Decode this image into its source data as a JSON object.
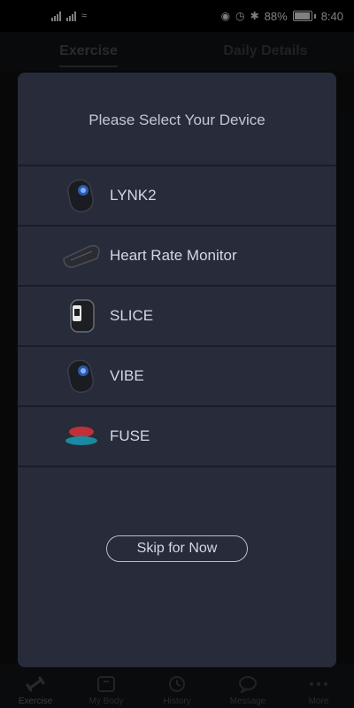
{
  "status_bar": {
    "battery": "88%",
    "time": "8:40"
  },
  "app": {
    "tabs": [
      "Exercise",
      "Daily Details"
    ],
    "bottom_nav": [
      {
        "label": "Exercise",
        "icon": "dumbbell-icon"
      },
      {
        "label": "My Body",
        "icon": "scale-icon"
      },
      {
        "label": "History",
        "icon": "history-icon"
      },
      {
        "label": "Message",
        "icon": "message-icon"
      },
      {
        "label": "More",
        "icon": "more-icon"
      }
    ]
  },
  "dialog": {
    "title": "Please Select Your Device",
    "devices": [
      {
        "label": "LYNK2",
        "icon": "lynk2-device-icon"
      },
      {
        "label": "Heart Rate Monitor",
        "icon": "heart-rate-monitor-icon"
      },
      {
        "label": "SLICE",
        "icon": "slice-device-icon"
      },
      {
        "label": "VIBE",
        "icon": "vibe-device-icon"
      },
      {
        "label": "FUSE",
        "icon": "fuse-device-icon"
      }
    ],
    "skip_label": "Skip for Now"
  }
}
